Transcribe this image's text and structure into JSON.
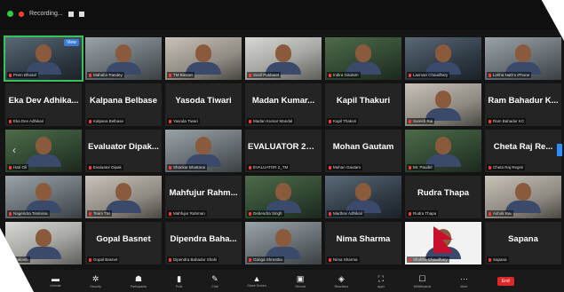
{
  "topbar": {
    "recording_label": "Recording..."
  },
  "grid": {
    "view_button": "View",
    "page_prev_glyph": "1",
    "tiles": [
      {
        "big": "",
        "label": "Prem Bhusal"
      },
      {
        "big": "",
        "label": "Mahabir Pandey"
      },
      {
        "big": "",
        "label": "TM Basnet"
      },
      {
        "big": "",
        "label": "Sunil Pokharel"
      },
      {
        "big": "",
        "label": "Indira Gautam"
      },
      {
        "big": "",
        "label": "Laxman Chaudhary"
      },
      {
        "big": "",
        "label": "Lekha Nath's iPhone"
      },
      {
        "big": "Eka Dev Adhika...",
        "label": "Eka Dev Adhikari"
      },
      {
        "big": "Kalpana Belbase",
        "label": "Kalpana Belbase"
      },
      {
        "big": "Yasoda Tiwari",
        "label": "Yasoda Tiwari"
      },
      {
        "big": "Madan Kumar...",
        "label": "Madan Kumar Mandal"
      },
      {
        "big": "Kapil Thakuri",
        "label": "Kapil Thakuri"
      },
      {
        "big": "",
        "label": "Suresh Rai"
      },
      {
        "big": "Ram Bahadur K...",
        "label": "Ram Bahadur KC"
      },
      {
        "big": "",
        "label": "Hari Oli"
      },
      {
        "big": "Evaluator Dipak...",
        "label": "Evaluator Dipak"
      },
      {
        "big": "",
        "label": "Shankar Bhattarai"
      },
      {
        "big": "EVALUATOR 2_T...",
        "label": "EVALUATOR 2_TM"
      },
      {
        "big": "Mohan Gautam",
        "label": "Mohan Gautam"
      },
      {
        "big": "",
        "label": "Mr. Paudel"
      },
      {
        "big": "Cheta Raj Re...",
        "label": "Cheta Raj Regmi"
      },
      {
        "big": "",
        "label": "Nagendra Timilsina"
      },
      {
        "big": "",
        "label": "Team TM"
      },
      {
        "big": "Mahfujur Rahm...",
        "label": "Mahfujur Rahman"
      },
      {
        "big": "",
        "label": "Debendra Singh"
      },
      {
        "big": "",
        "label": "Madhav Adhikari"
      },
      {
        "big": "Rudra Thapa",
        "label": "Rudra Thapa"
      },
      {
        "big": "",
        "label": "Ashok Rai"
      },
      {
        "big": "",
        "label": "Prakash"
      },
      {
        "big": "Gopal Basnet",
        "label": "Gopal Basnet"
      },
      {
        "big": "Dipendra Baha...",
        "label": "Dipendra Bahadur Shahi"
      },
      {
        "big": "",
        "label": "Ganga Shrestha"
      },
      {
        "big": "Nima Sharma",
        "label": "Nima Sharma"
      },
      {
        "big": "",
        "label": "Shobha Chaudhary"
      },
      {
        "big": "Sapana",
        "label": "Sapana"
      }
    ]
  },
  "toolbar": {
    "items": [
      {
        "glyph": "▬",
        "label": "Unmute"
      },
      {
        "glyph": "✲",
        "label": "Security"
      },
      {
        "glyph": "☗",
        "label": "Participants"
      },
      {
        "glyph": "▮",
        "label": "Polls"
      },
      {
        "glyph": "✎",
        "label": "Chat"
      },
      {
        "glyph": "▲",
        "label": "Share Screen"
      },
      {
        "glyph": "▣",
        "label": "Record"
      },
      {
        "glyph": "◈",
        "label": "Reactions"
      },
      {
        "glyph": "⛶",
        "label": "Apps"
      },
      {
        "glyph": "☐",
        "label": "Whiteboards"
      },
      {
        "glyph": "⋯",
        "label": "More"
      }
    ],
    "end_label": "End"
  }
}
